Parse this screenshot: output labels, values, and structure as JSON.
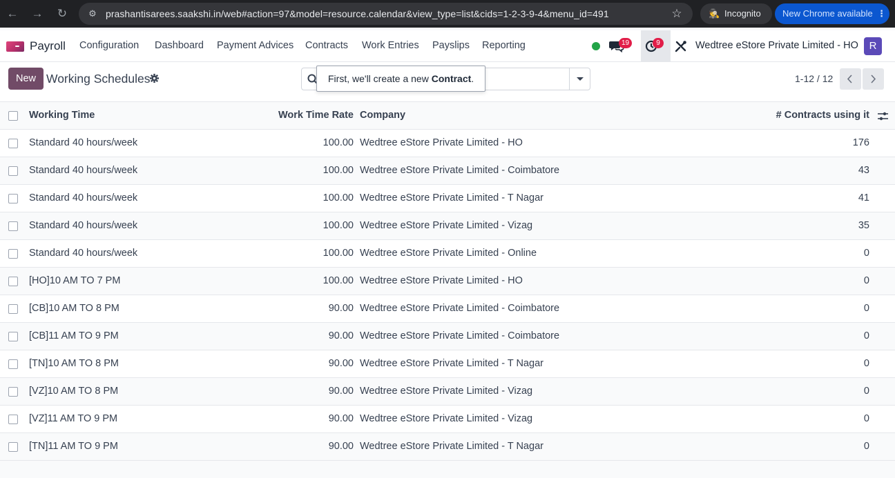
{
  "browser": {
    "url": "prashantisarees.saakshi.in/web#action=97&model=resource.calendar&view_type=list&cids=1-2-3-9-4&menu_id=491",
    "incognito_label": "Incognito",
    "update_label": "New Chrome available"
  },
  "navbar": {
    "app_name": "Payroll",
    "menu": [
      {
        "label": "Configuration"
      },
      {
        "label": "Dashboard"
      },
      {
        "label": "Payment Advices"
      },
      {
        "label": "Contracts"
      },
      {
        "label": "Work Entries"
      },
      {
        "label": "Payslips"
      },
      {
        "label": "Reporting"
      }
    ],
    "messages_count": "19",
    "activities_count": "9",
    "company": "Wedtree eStore Private Limited - HO",
    "avatar_initial": "R",
    "presence_color": "#22a447"
  },
  "control": {
    "new_label": "New",
    "title": "Working Schedules",
    "tooltip_prefix": "First, we'll create a new ",
    "tooltip_strong": "Contract",
    "tooltip_suffix": ".",
    "pager": "1-12 / 12"
  },
  "table": {
    "headers": {
      "working_time": "Working Time",
      "rate": "Work Time Rate",
      "company": "Company",
      "contracts": "# Contracts using it"
    },
    "rows": [
      {
        "name": "Standard 40 hours/week",
        "rate": "100.00",
        "company": "Wedtree eStore Private Limited - HO",
        "contracts": "176"
      },
      {
        "name": "Standard 40 hours/week",
        "rate": "100.00",
        "company": "Wedtree eStore Private Limited - Coimbatore",
        "contracts": "43"
      },
      {
        "name": "Standard 40 hours/week",
        "rate": "100.00",
        "company": "Wedtree eStore Private Limited - T Nagar",
        "contracts": "41"
      },
      {
        "name": "Standard 40 hours/week",
        "rate": "100.00",
        "company": "Wedtree eStore Private Limited - Vizag",
        "contracts": "35"
      },
      {
        "name": "Standard 40 hours/week",
        "rate": "100.00",
        "company": "Wedtree eStore Private Limited - Online",
        "contracts": "0"
      },
      {
        "name": "[HO]10 AM TO 7 PM",
        "rate": "100.00",
        "company": "Wedtree eStore Private Limited - HO",
        "contracts": "0"
      },
      {
        "name": "[CB]10 AM TO 8 PM",
        "rate": "90.00",
        "company": "Wedtree eStore Private Limited - Coimbatore",
        "contracts": "0"
      },
      {
        "name": "[CB]11 AM TO 9 PM",
        "rate": "90.00",
        "company": "Wedtree eStore Private Limited - Coimbatore",
        "contracts": "0"
      },
      {
        "name": "[TN]10 AM TO 8 PM",
        "rate": "90.00",
        "company": "Wedtree eStore Private Limited - T Nagar",
        "contracts": "0"
      },
      {
        "name": "[VZ]10 AM TO 8 PM",
        "rate": "90.00",
        "company": "Wedtree eStore Private Limited - Vizag",
        "contracts": "0"
      },
      {
        "name": "[VZ]11 AM TO 9 PM",
        "rate": "90.00",
        "company": "Wedtree eStore Private Limited - Vizag",
        "contracts": "0"
      },
      {
        "name": "[TN]11 AM TO 9 PM",
        "rate": "90.00",
        "company": "Wedtree eStore Private Limited - T Nagar",
        "contracts": "0"
      }
    ]
  }
}
